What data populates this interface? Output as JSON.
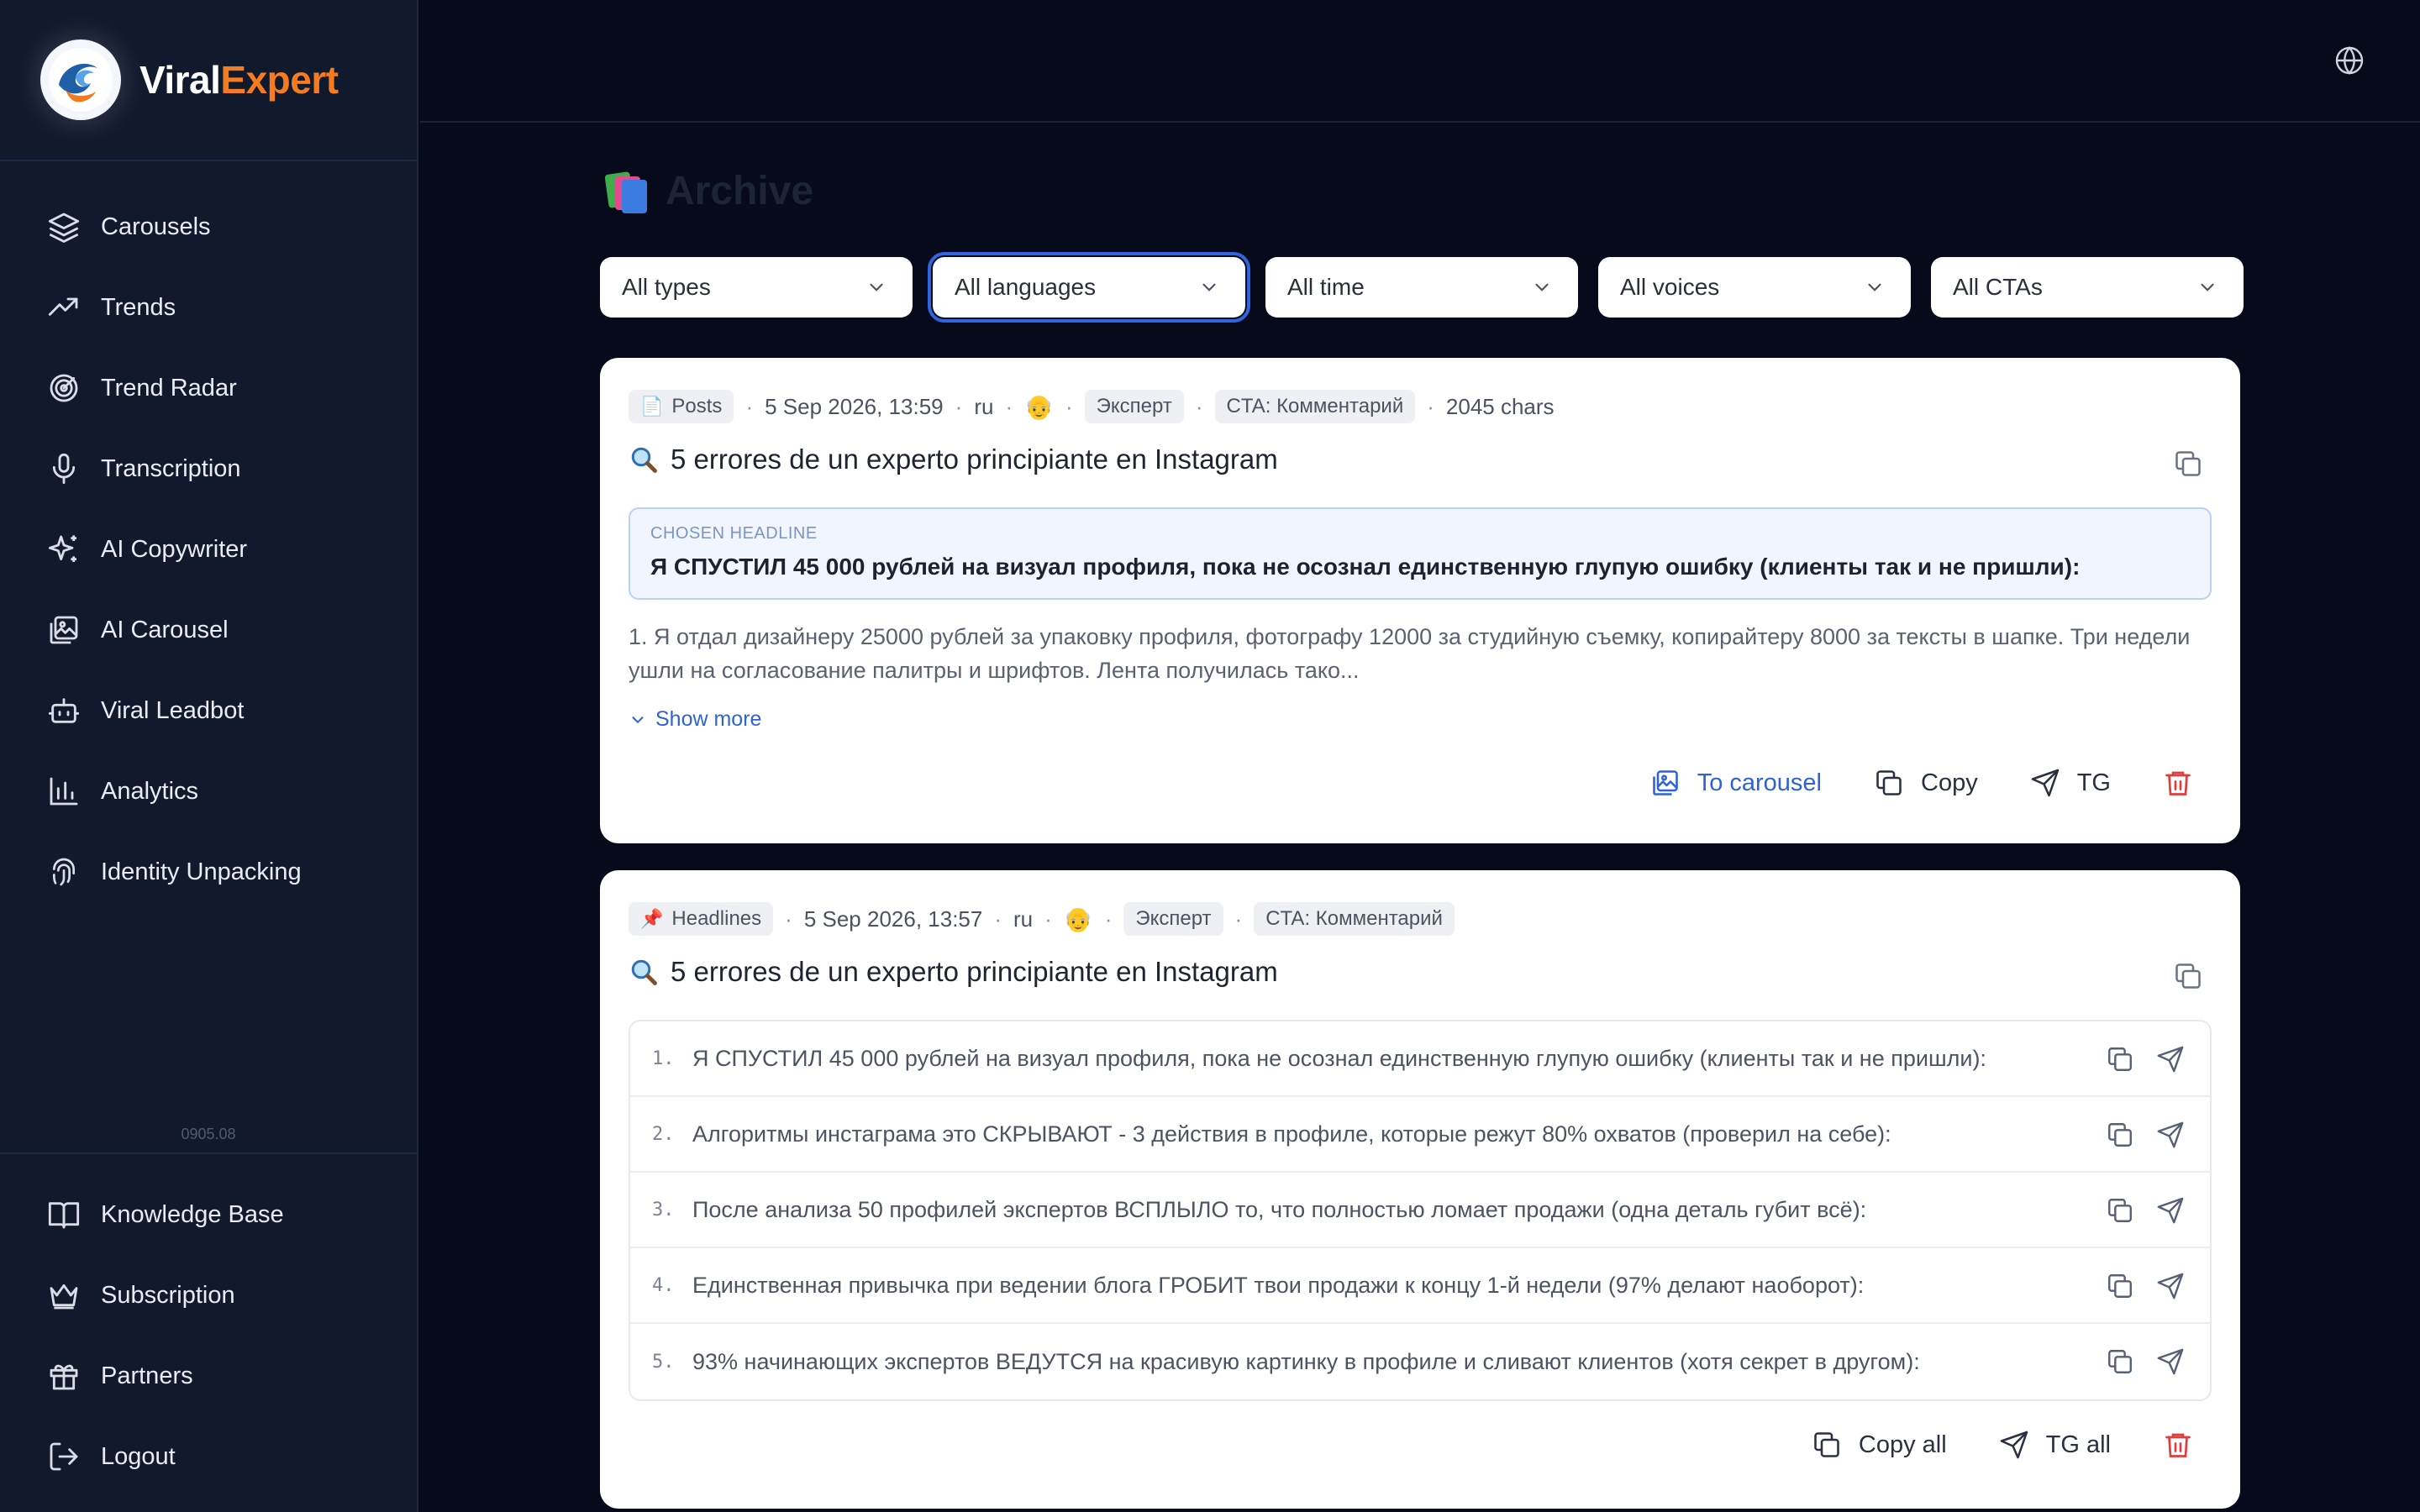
{
  "brand": {
    "name_part1": "Viral",
    "name_part2": "Expert"
  },
  "sidebar": {
    "items": [
      {
        "label": "Carousels",
        "icon": "layers-icon"
      },
      {
        "label": "Trends",
        "icon": "trending-up-icon"
      },
      {
        "label": "Trend Radar",
        "icon": "radar-icon"
      },
      {
        "label": "Transcription",
        "icon": "microphone-icon"
      },
      {
        "label": "AI Copywriter",
        "icon": "sparkles-icon"
      },
      {
        "label": "AI Carousel",
        "icon": "image-gallery-icon"
      },
      {
        "label": "Viral Leadbot",
        "icon": "bot-icon"
      },
      {
        "label": "Analytics",
        "icon": "bar-chart-icon"
      },
      {
        "label": "Identity Unpacking",
        "icon": "fingerprint-icon"
      }
    ],
    "version": "0905.08",
    "bottom_items": [
      {
        "label": "Knowledge Base",
        "icon": "book-open-icon"
      },
      {
        "label": "Subscription",
        "icon": "crown-icon"
      },
      {
        "label": "Partners",
        "icon": "gift-icon"
      },
      {
        "label": "Logout",
        "icon": "logout-icon"
      }
    ]
  },
  "topbar": {
    "icon": "globe-icon"
  },
  "page": {
    "title": "Archive",
    "title_icon": "books-icon"
  },
  "filters": [
    {
      "value": "All types"
    },
    {
      "value": "All languages",
      "focused": true
    },
    {
      "value": "All time"
    },
    {
      "value": "All voices"
    },
    {
      "value": "All CTAs"
    }
  ],
  "cards": [
    {
      "type": "Posts",
      "date": "5 Sep 2026, 13:59",
      "lang": "ru",
      "voice": "Эксперт",
      "cta": "CTA: Комментарий",
      "chars": "2045 chars",
      "title": "5 errores de un experto principiante en Instagram",
      "headline_label": "CHOSEN HEADLINE",
      "headline": "Я СПУСТИЛ 45 000 рублей на визуал профиля, пока не осознал единственную глупую ошибку (клиенты так и не пришли):",
      "body": "1. Я отдал дизайнеру 25000 рублей за упаковку профиля, фотографу 12000 за студийную съемку, копирайтеру 8000 за тексты в шапке. Три недели ушли на согласование палитры и шрифтов. Лента получилась тако...",
      "show_more": "Show more",
      "actions": {
        "to_carousel": "To carousel",
        "copy": "Copy",
        "tg": "TG"
      }
    },
    {
      "type": "Headlines",
      "date": "5 Sep 2026, 13:57",
      "lang": "ru",
      "voice": "Эксперт",
      "cta": "CTA: Комментарий",
      "title": "5 errores de un experto principiante en Instagram",
      "headlines": [
        {
          "num": "1.",
          "text": "Я СПУСТИЛ 45 000 рублей на визуал профиля, пока не осознал единственную глупую ошибку (клиенты так и не пришли):"
        },
        {
          "num": "2.",
          "text": "Алгоритмы инстаграма это СКРЫВАЮТ - 3 действия в профиле, которые режут 80% охватов (проверил на себе):"
        },
        {
          "num": "3.",
          "text": "После анализа 50 профилей экспертов ВСПЛЫЛО то, что полностью ломает продажи (одна деталь губит всё):"
        },
        {
          "num": "4.",
          "text": "Единственная привычка при ведении блога ГРОБИТ твои продажи к концу 1-й недели (97% делают наоборот):"
        },
        {
          "num": "5.",
          "text": "93% начинающих экспертов ВЕДУТСЯ на красивую картинку в профиле и сливают клиентов (хотя секрет в другом):"
        }
      ],
      "actions": {
        "copy_all": "Copy all",
        "tg_all": "TG all"
      }
    }
  ]
}
